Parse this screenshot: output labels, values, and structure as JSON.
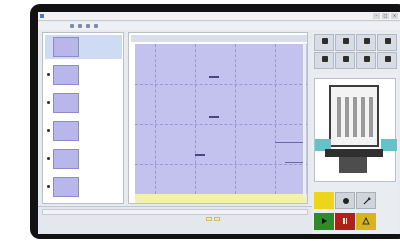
{
  "window": {
    "title": ""
  },
  "toolbar": {
    "label": ""
  },
  "thumbnails": [
    {
      "lines": [
        "",
        "",
        ""
      ],
      "selected": true
    },
    {
      "lines": [
        "",
        "",
        ""
      ],
      "selected": false
    },
    {
      "lines": [
        "",
        "",
        ""
      ],
      "selected": false
    },
    {
      "lines": [
        "",
        "",
        ""
      ],
      "selected": false
    },
    {
      "lines": [
        "",
        "",
        ""
      ],
      "selected": false
    },
    {
      "lines": [
        "",
        "",
        ""
      ],
      "selected": false
    }
  ],
  "canvas": {
    "tabs": [
      "",
      ""
    ]
  },
  "right_panel": {
    "icon_buttons": [
      {
        "label": ""
      },
      {
        "label": ""
      },
      {
        "label": ""
      },
      {
        "label": ""
      },
      {
        "label": ""
      },
      {
        "label": ""
      },
      {
        "label": ""
      },
      {
        "label": ""
      }
    ],
    "option_row": ""
  },
  "controls": {
    "yellow_label": "",
    "icons": [
      "cursor-icon",
      "record-icon",
      "wrench-icon",
      "play-icon",
      "stop-icon",
      "warning-icon"
    ]
  },
  "bottombar": {
    "status": "",
    "items": [
      "",
      "",
      "",
      "",
      "",
      ""
    ],
    "yellow_tabs": [
      "",
      ""
    ]
  },
  "colors": {
    "bezel": "#121212",
    "plot_fill": "#c3c2ee",
    "band_yellow": "#f4f1aa",
    "selected_thumb": "#cfdaf3",
    "go_green": "#2f8a2a",
    "stop_red": "#b31e1e",
    "accent_yellow": "#ecd51b"
  }
}
